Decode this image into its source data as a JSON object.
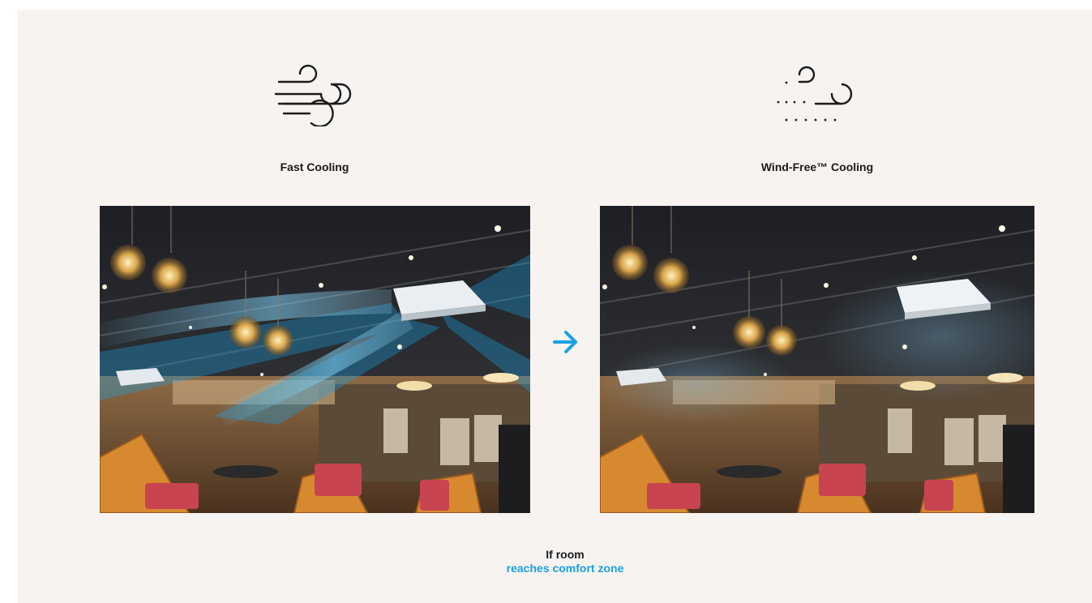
{
  "left": {
    "icon": "wind-gust-icon",
    "title": "Fast Cooling",
    "image": "cafe-interior-strong-airflow-photo"
  },
  "right": {
    "icon": "wind-free-breeze-icon",
    "title": "Wind-Free™ Cooling",
    "image": "cafe-interior-gentle-airflow-photo"
  },
  "transition_icon": "arrow-right-icon",
  "caption": {
    "line1": "If room",
    "line2": "reaches comfort zone"
  },
  "colors": {
    "background": "#f6f3f0",
    "accent": "#1aa1e3",
    "text": "#1b1b1b"
  }
}
